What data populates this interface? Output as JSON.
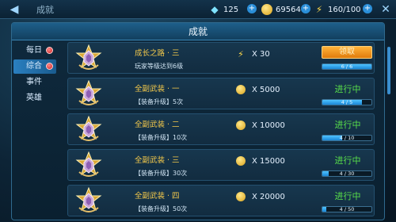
{
  "topbar": {
    "title": "成就",
    "back_icon": "back-arrow-icon",
    "diamond": "125",
    "gold": "69564",
    "energy": "160/100",
    "close_icon": "close-icon"
  },
  "panel": {
    "title": "成就"
  },
  "tabs": [
    {
      "label": "每日",
      "has_dot": true
    },
    {
      "label": "综合",
      "has_dot": true,
      "active": true
    },
    {
      "label": "事件",
      "has_dot": false
    },
    {
      "label": "英雄",
      "has_dot": false
    }
  ],
  "achievements": [
    {
      "title": "成长之路 · 三",
      "desc": "玩家等级达到6级",
      "reward_type": "energy",
      "reward": "X 30",
      "status": "claim",
      "claim_label": "领取",
      "progress_text": "6 / 6",
      "progress": 1.0
    },
    {
      "title": "全副武装 · 一",
      "desc": "【装备升级】5次",
      "reward_type": "coin",
      "reward": "X 5000",
      "status": "in-progress",
      "status_label": "进行中",
      "progress_text": "4 / 5",
      "progress": 0.8
    },
    {
      "title": "全副武装 · 二",
      "desc": "【装备升级】10次",
      "reward_type": "coin",
      "reward": "X 10000",
      "status": "in-progress",
      "status_label": "进行中",
      "progress_text": "4 / 10",
      "progress": 0.4
    },
    {
      "title": "全副武装 · 三",
      "desc": "【装备升级】30次",
      "reward_type": "coin",
      "reward": "X 15000",
      "status": "in-progress",
      "status_label": "进行中",
      "progress_text": "4 / 30",
      "progress": 0.13
    },
    {
      "title": "全副武装 · 四",
      "desc": "【装备升级】50次",
      "reward_type": "coin",
      "reward": "X 20000",
      "status": "in-progress",
      "status_label": "进行中",
      "progress_text": "4 / 50",
      "progress": 0.08
    }
  ],
  "colors": {
    "accent": "#2b8fd9",
    "gold_text": "#f2c84b",
    "in_progress": "#59e04a"
  }
}
